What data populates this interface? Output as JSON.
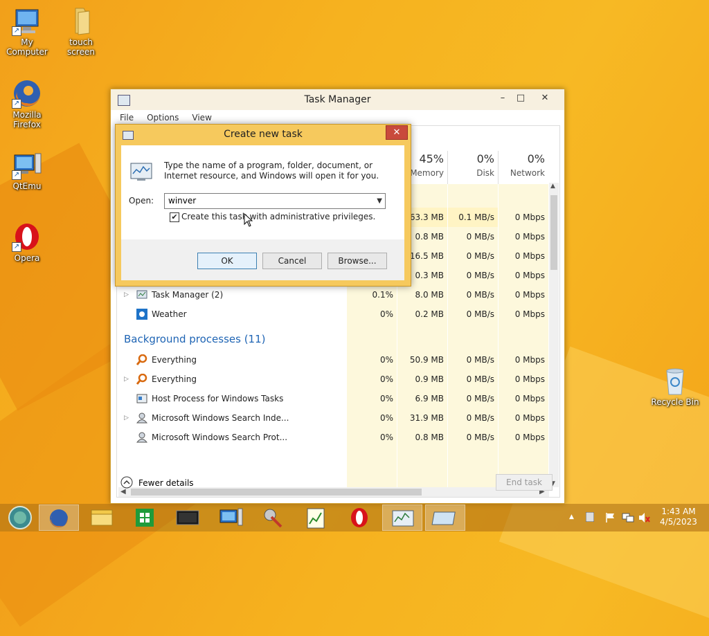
{
  "desktop": {
    "icons": [
      {
        "label": "My Computer"
      },
      {
        "label": "touch screen"
      },
      {
        "label": "Mozilla Firefox"
      },
      {
        "label": "QtEmu"
      },
      {
        "label": "Opera"
      },
      {
        "label": "Recycle Bin"
      }
    ]
  },
  "task_manager": {
    "title": "Task Manager",
    "controls": {
      "minimize": "–",
      "maximize": "□",
      "close": "✕"
    },
    "menu": [
      "File",
      "Options",
      "View"
    ],
    "columns": [
      {
        "pct": "45%",
        "name": "Memory"
      },
      {
        "pct": "0%",
        "name": "Disk"
      },
      {
        "pct": "0%",
        "name": "Network"
      }
    ],
    "top_rows": [
      {
        "memory": "263.3 MB",
        "disk": "0.1 MB/s",
        "network": "0 Mbps"
      },
      {
        "memory": "0.8 MB",
        "disk": "0 MB/s",
        "network": "0 Mbps"
      },
      {
        "memory": "16.5 MB",
        "disk": "0 MB/s",
        "network": "0 Mbps"
      },
      {
        "memory": "0.3 MB",
        "disk": "0 MB/s",
        "network": "0 Mbps"
      }
    ],
    "apps": [
      {
        "name": "Task Manager (2)",
        "cpu": "0.1%",
        "memory": "8.0 MB",
        "disk": "0 MB/s",
        "network": "0 Mbps"
      },
      {
        "name": "Weather",
        "cpu": "0%",
        "memory": "0.2 MB",
        "disk": "0 MB/s",
        "network": "0 Mbps"
      }
    ],
    "background_header": "Background processes (11)",
    "background": [
      {
        "name": "Everything",
        "cpu": "0%",
        "memory": "50.9 MB",
        "disk": "0 MB/s",
        "network": "0 Mbps"
      },
      {
        "name": "Everything",
        "cpu": "0%",
        "memory": "0.9 MB",
        "disk": "0 MB/s",
        "network": "0 Mbps"
      },
      {
        "name": "Host Process for Windows Tasks",
        "cpu": "0%",
        "memory": "6.9 MB",
        "disk": "0 MB/s",
        "network": "0 Mbps"
      },
      {
        "name": "Microsoft Windows Search Inde...",
        "cpu": "0%",
        "memory": "31.9 MB",
        "disk": "0 MB/s",
        "network": "0 Mbps"
      },
      {
        "name": "Microsoft Windows Search Prot...",
        "cpu": "0%",
        "memory": "0.8 MB",
        "disk": "0 MB/s",
        "network": "0 Mbps"
      }
    ],
    "fewer_details": "Fewer details",
    "end_task": "End task"
  },
  "dialog": {
    "title": "Create new task",
    "close": "✕",
    "description": "Type the name of a program, folder, document, or Internet resource, and Windows will open it for you.",
    "open_label": "Open:",
    "open_value": "winver",
    "admin_checkbox_label": "Create this task with administrative privileges.",
    "admin_checked": true,
    "ok": "OK",
    "cancel": "Cancel",
    "browse": "Browse..."
  },
  "taskbar": {
    "time": "1:43 AM",
    "date": "4/5/2023"
  }
}
